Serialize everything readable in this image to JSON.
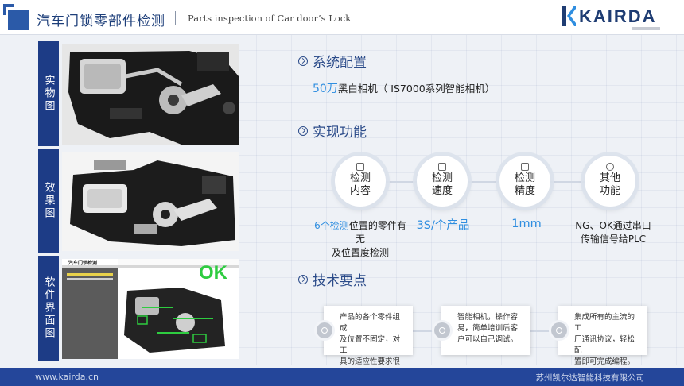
{
  "header": {
    "title_cn": "汽车门锁零部件检测",
    "title_en": "Parts inspection of Car door’s Lock",
    "logo": "KAIRDA"
  },
  "panels": [
    {
      "label": "实物图"
    },
    {
      "label": "效果图"
    },
    {
      "label": "软件界面图",
      "ok_text": "OK",
      "screen_title": "汽车门锁检测"
    }
  ],
  "sections": {
    "config": {
      "title": "系统配置",
      "highlight": "50万",
      "text": "黑白相机（ IS7000系列智能相机）"
    },
    "features": {
      "title": "实现功能",
      "items": [
        {
          "name_line1": "检测",
          "name_line2": "内容",
          "icon": "document-icon"
        },
        {
          "name_line1": "检测",
          "name_line2": "速度",
          "icon": "rocket-icon"
        },
        {
          "name_line1": "检测",
          "name_line2": "精度",
          "icon": "ruler-icon"
        },
        {
          "name_line1": "其他",
          "name_line2": "功能",
          "icon": "shield-icon"
        }
      ],
      "desc1_hl": "6个检测",
      "desc1_a": "位置的零件有无",
      "desc1_b": "及位置度检测",
      "desc2": "3S/个产品",
      "desc3": "1mm",
      "desc4_a": "NG、OK通过串口",
      "desc4_b": "传输信号给PLC"
    },
    "tech": {
      "title": "技术要点",
      "cards": [
        {
          "line1": "产品的各个零件组成",
          "line2": "及位置不固定，对工",
          "line3": "具的适应性要求很高",
          "icon": "search-icon"
        },
        {
          "line1": "智能相机，操作容",
          "line2": "易，简单培训后客",
          "line3": "户可以自己调试。",
          "icon": "gear-icon"
        },
        {
          "line1": "集成所有的主流的工",
          "line2": "厂通讯协议，轻松配",
          "line3": "置即可完成编程。",
          "icon": "wrench-icon"
        }
      ]
    }
  },
  "footer": {
    "website": "www.kairda.cn",
    "company": "苏州凯尔达智能科技有限公司"
  },
  "colors": {
    "primary": "#24469a",
    "accent": "#2f8ee0",
    "label_bg": "#1d3c86"
  }
}
